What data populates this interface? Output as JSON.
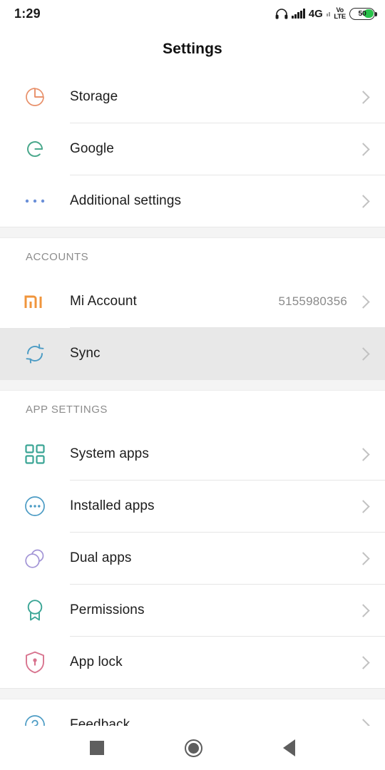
{
  "status_bar": {
    "time": "1:29",
    "headphone_icon": "headphone-icon",
    "signal_icon": "signal-bars-icon",
    "network_type": "4G",
    "volte_line1": "Vo",
    "volte_line2": "LTE",
    "battery_percent": "50",
    "battery_level": 50
  },
  "header": {
    "title": "Settings"
  },
  "groups": [
    {
      "id": "general",
      "header": null,
      "rows": [
        {
          "id": "storage",
          "label": "Storage",
          "value": "",
          "icon": "pie-chart-icon",
          "color": "#e8906a",
          "pressed": false
        },
        {
          "id": "google",
          "label": "Google",
          "value": "",
          "icon": "google-g-icon",
          "color": "#4aa88c",
          "pressed": false
        },
        {
          "id": "additional-settings",
          "label": "Additional settings",
          "value": "",
          "icon": "three-dots-icon",
          "color": "#6a8fd8",
          "pressed": false
        }
      ]
    },
    {
      "id": "accounts",
      "header": "ACCOUNTS",
      "rows": [
        {
          "id": "mi-account",
          "label": "Mi Account",
          "value": "5155980356",
          "icon": "mi-logo-icon",
          "color": "#f0953c",
          "pressed": false
        },
        {
          "id": "sync",
          "label": "Sync",
          "value": "",
          "icon": "sync-icon",
          "color": "#4b9bc4",
          "pressed": true
        }
      ]
    },
    {
      "id": "app-settings",
      "header": "APP SETTINGS",
      "rows": [
        {
          "id": "system-apps",
          "label": "System apps",
          "value": "",
          "icon": "grid-squares-icon",
          "color": "#3aa595",
          "pressed": false
        },
        {
          "id": "installed-apps",
          "label": "Installed apps",
          "value": "",
          "icon": "circle-dots-icon",
          "color": "#4b9bc4",
          "pressed": false
        },
        {
          "id": "dual-apps",
          "label": "Dual apps",
          "value": "",
          "icon": "dual-circles-icon",
          "color": "#a294d6",
          "pressed": false
        },
        {
          "id": "permissions",
          "label": "Permissions",
          "value": "",
          "icon": "award-ribbon-icon",
          "color": "#3aa595",
          "pressed": false
        },
        {
          "id": "app-lock",
          "label": "App lock",
          "value": "",
          "icon": "shield-lock-icon",
          "color": "#d8738e",
          "pressed": false
        }
      ]
    },
    {
      "id": "feedback-group",
      "header": null,
      "rows": [
        {
          "id": "feedback",
          "label": "Feedback",
          "value": "",
          "icon": "question-circle-icon",
          "color": "#4b9bc4",
          "pressed": false
        }
      ]
    }
  ],
  "nav_bar": {
    "recents_label": "Recents",
    "home_label": "Home",
    "back_label": "Back"
  },
  "colors": {
    "page_background": "#ffffff",
    "section_gap": "#f4f4f4",
    "divider": "#e6e6e6",
    "pressed_row": "#e8e8e8",
    "primary_text": "#1c1c1c",
    "secondary_text": "#8a8a8a",
    "battery_green": "#29c24a"
  }
}
